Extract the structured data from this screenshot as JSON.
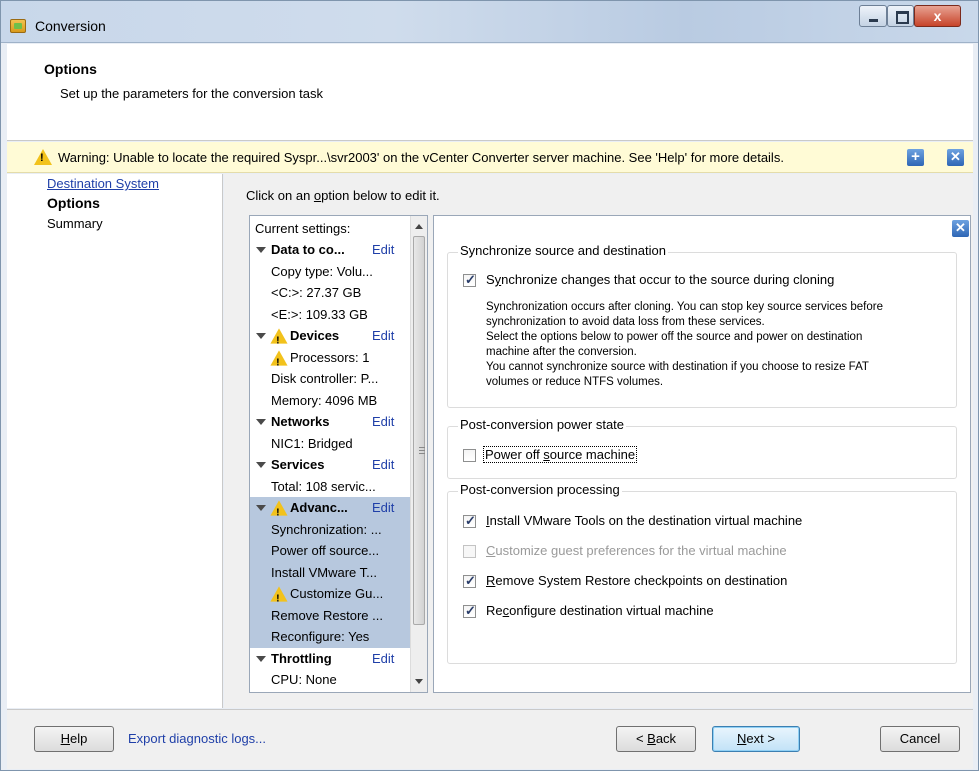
{
  "window": {
    "title": "Conversion"
  },
  "header": {
    "title": "Options",
    "subtitle": "Set up the parameters for the conversion task"
  },
  "warning": {
    "text": "Warning: Unable to locate the required Syspr...\\svr2003' on the vCenter Converter server machine. See 'Help' for more details.",
    "expand_icon": "plus-icon",
    "close_icon": "close-icon"
  },
  "nav": {
    "items": [
      {
        "label": "Destination System",
        "state": "link"
      },
      {
        "label": "Options",
        "state": "current"
      },
      {
        "label": "Summary",
        "state": "plain"
      }
    ]
  },
  "content": {
    "instruction_pre": "Click on an ",
    "instruction_key": "o",
    "instruction_post": "ption below to edit it."
  },
  "tree": {
    "header": "Current settings:",
    "edit_label": "Edit",
    "rows": [
      {
        "text": "Data to co...",
        "kind": "section",
        "edit": true
      },
      {
        "text": "Copy type: Volu...",
        "kind": "item"
      },
      {
        "text": "<C:>: 27.37 GB",
        "kind": "item"
      },
      {
        "text": "<E:>: 109.33 GB",
        "kind": "item"
      },
      {
        "text": "Devices",
        "kind": "section-warn",
        "edit": true
      },
      {
        "text": "Processors: 1",
        "kind": "item-warn"
      },
      {
        "text": "Disk controller: P...",
        "kind": "item"
      },
      {
        "text": "Memory: 4096 MB",
        "kind": "item"
      },
      {
        "text": "Networks",
        "kind": "section",
        "edit": true
      },
      {
        "text": "NIC1: Bridged",
        "kind": "item"
      },
      {
        "text": "Services",
        "kind": "section",
        "edit": true
      },
      {
        "text": "Total: 108 servic...",
        "kind": "item"
      },
      {
        "text": "Advanc...",
        "kind": "section-warn",
        "edit": true,
        "selected": true
      },
      {
        "text": "Synchronization: ...",
        "kind": "item",
        "selected": true
      },
      {
        "text": "Power off source...",
        "kind": "item",
        "selected": true
      },
      {
        "text": "Install VMware T...",
        "kind": "item",
        "selected": true
      },
      {
        "text": "Customize Gu...",
        "kind": "item-warn",
        "selected": true
      },
      {
        "text": "Remove Restore ...",
        "kind": "item",
        "selected": true
      },
      {
        "text": "Reconfigure: Yes",
        "kind": "item",
        "selected": true
      },
      {
        "text": "Throttling",
        "kind": "section",
        "edit": true
      },
      {
        "text": "CPU: None",
        "kind": "item"
      }
    ]
  },
  "options": {
    "sync_group": {
      "title": "Synchronize source and destination",
      "checkbox_key": "y",
      "checkbox_pre": "S",
      "checkbox_post": "nchronize changes that occur to the source during cloning",
      "checked": true,
      "description": [
        "Synchronization occurs after cloning. You can stop key source services before",
        "synchronization to avoid data loss from these services.",
        "Select the options below to power off the source and power on destination",
        "machine after the conversion.",
        "You cannot synchronize source with destination if you choose to resize FAT",
        "volumes or reduce NTFS volumes."
      ]
    },
    "power_group": {
      "title": "Post-conversion power state",
      "checkbox_pre": "Power off ",
      "checkbox_key": "s",
      "checkbox_post": "ource machine",
      "checked": false
    },
    "processing_group": {
      "title": "Post-conversion processing",
      "items": [
        {
          "pre": "",
          "key": "I",
          "post": "nstall VMware Tools on the destination virtual machine",
          "checked": true,
          "disabled": false
        },
        {
          "pre": "",
          "key": "C",
          "post": "ustomize guest preferences for the virtual machine",
          "checked": false,
          "disabled": true
        },
        {
          "pre": "",
          "key": "R",
          "post": "emove System Restore checkpoints on destination",
          "checked": true,
          "disabled": false
        },
        {
          "pre": "Re",
          "key": "c",
          "post": "onfigure destination virtual machine",
          "checked": true,
          "disabled": false
        }
      ]
    }
  },
  "footer": {
    "help_key": "H",
    "help_rest": "elp",
    "export_label": "Export diagnostic logs...",
    "back_pre": "< ",
    "back_key": "B",
    "back_rest": "ack",
    "next_key": "N",
    "next_rest": "ext >",
    "cancel_label": "Cancel"
  },
  "colors": {
    "link": "#1f3fa8",
    "selection": "#b7c8de",
    "warning_bg": "#fffbd6",
    "warning_icon": "#f2c21c"
  }
}
